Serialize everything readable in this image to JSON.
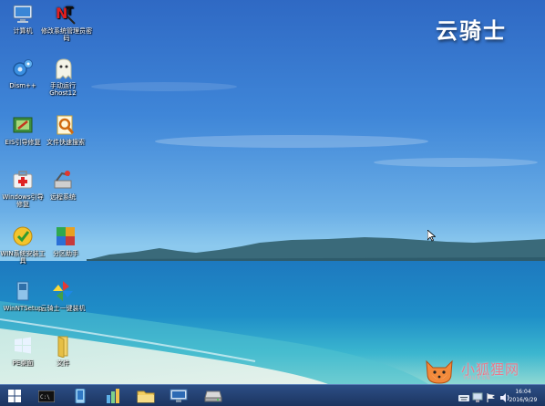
{
  "branding": {
    "logo_text": "云骑士"
  },
  "watermark": {
    "text": "小狐狸网",
    "subtext": "YHUKSN"
  },
  "desktop_icons": [
    {
      "label": "计算机",
      "icon": "computer-icon"
    },
    {
      "label": "修改系统管理员密码",
      "icon": "nt-password-icon"
    },
    {
      "label": "Dism++",
      "icon": "dism-gear-icon"
    },
    {
      "label": "手动运行Ghost12",
      "icon": "ghost-icon"
    },
    {
      "label": "EIS引导修复",
      "icon": "boot-repair-icon"
    },
    {
      "label": "文件快速搜索",
      "icon": "file-search-icon"
    },
    {
      "label": "Windows引导修复",
      "icon": "first-aid-kit-icon"
    },
    {
      "label": "远程系统",
      "icon": "remote-system-icon"
    },
    {
      "label": "WIN系统安装工具",
      "icon": "win-install-tool-icon"
    },
    {
      "label": "分区助手",
      "icon": "partition-assistant-icon"
    },
    {
      "label": "WinNTSetup",
      "icon": "winntsetup-icon"
    },
    {
      "label": "云骑士一键装机",
      "icon": "pinwheel-icon"
    },
    {
      "label": "PE桌面",
      "icon": "windows-logo-icon"
    },
    {
      "label": "文件",
      "icon": "folder-icon"
    }
  ],
  "taskbar": {
    "start_icon": "windows-start-icon",
    "items": [
      {
        "name": "cmd-icon"
      },
      {
        "name": "phone-icon"
      },
      {
        "name": "tools-icon"
      },
      {
        "name": "explorer-folder-icon"
      },
      {
        "name": "monitor-icon"
      },
      {
        "name": "disk-drive-icon"
      }
    ],
    "tray": {
      "icons": [
        "keyboard-icon",
        "network-icon",
        "flag-icon",
        "volume-icon"
      ],
      "time": "16:04",
      "date": "2016/9/29"
    }
  }
}
